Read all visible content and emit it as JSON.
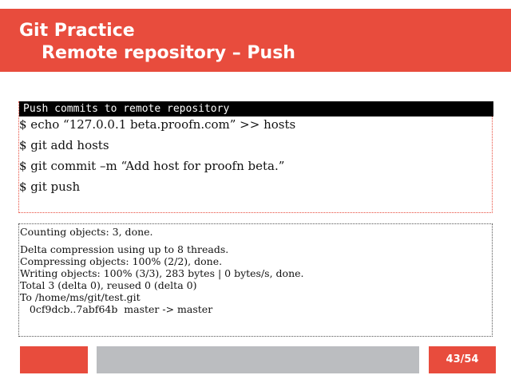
{
  "header": {
    "title": "Git Practice",
    "subtitle": "Remote repository – Push"
  },
  "command_panel": {
    "caption": "Push commits to remote repository",
    "lines": [
      "$ echo “127.0.0.1 beta.proofn.com” >> hosts",
      "$ git add hosts",
      "$ git commit –m “Add host for proofn beta.”",
      "$ git push"
    ]
  },
  "output_panel": {
    "lines": [
      "Counting objects: 3, done.",
      "Delta compression using up to 8 threads.",
      "Compressing objects: 100% (2/2), done.",
      "Writing objects: 100% (3/3), 283 bytes | 0 bytes/s, done.",
      "Total 3 (delta 0), reused 0 (delta 0)",
      "To /home/ms/git/test.git",
      "   0cf9dcb..7abf64b  master -> master"
    ]
  },
  "footer": {
    "page_number": "43/54"
  },
  "colors": {
    "accent": "#e84c3d",
    "footer_gray": "#bbbdc0",
    "caption_bg": "#000000"
  }
}
